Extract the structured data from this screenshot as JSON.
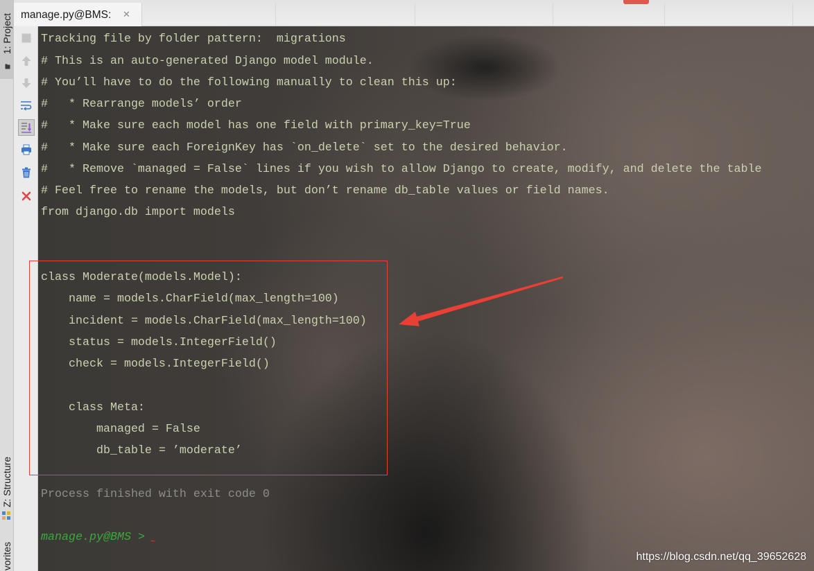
{
  "window": {
    "tab_label": "manage.py@BMS:",
    "tab_close_glyph": "✕"
  },
  "left_rail": {
    "project_tab": "1: Project",
    "structure_tab": "Z: Structure",
    "favorites_tab": "vorites"
  },
  "toolbar": {
    "icons": [
      "stop-icon",
      "scroll-up-icon",
      "scroll-down-icon",
      "soft-wrap-icon",
      "scroll-to-end-icon",
      "print-icon",
      "clear-all-icon",
      "close-icon"
    ]
  },
  "console": {
    "header_lines": [
      "Tracking file by folder pattern:  migrations",
      "# This is an auto-generated Django model module.",
      "# You’ll have to do the following manually to clean this up:",
      "#   * Rearrange models’ order",
      "#   * Make sure each model has one field with primary_key=True",
      "#   * Make sure each ForeignKey has `on_delete` set to the desired behavior.",
      "#   * Remove `managed = False` lines if you wish to allow Django to create, modify, and delete the table",
      "# Feel free to rename the models, but don’t rename db_table values or field names.",
      "from django.db import models"
    ],
    "model_lines": [
      "class Moderate(models.Model):",
      "    name = models.CharField(max_length=100)",
      "    incident = models.CharField(max_length=100)",
      "    status = models.IntegerField()",
      "    check = models.IntegerField()"
    ],
    "meta_lines": [
      "    class Meta:",
      "        managed = False",
      "        db_table = ’moderate’"
    ],
    "exit_message": "Process finished with exit code 0",
    "prompt": "manage.py@BMS >",
    "prompt_marker": "~"
  },
  "watermark": "https://blog.csdn.net/qq_39652628",
  "colors": {
    "console_text": "#cad2af",
    "exit_text": "#8d8d8a",
    "prompt_text": "#3ba83b",
    "annotation_red": "#ea3f35",
    "icon_blue": "#3a78c6",
    "icon_disabled": "#c4c4c4",
    "close_red": "#e04545"
  }
}
